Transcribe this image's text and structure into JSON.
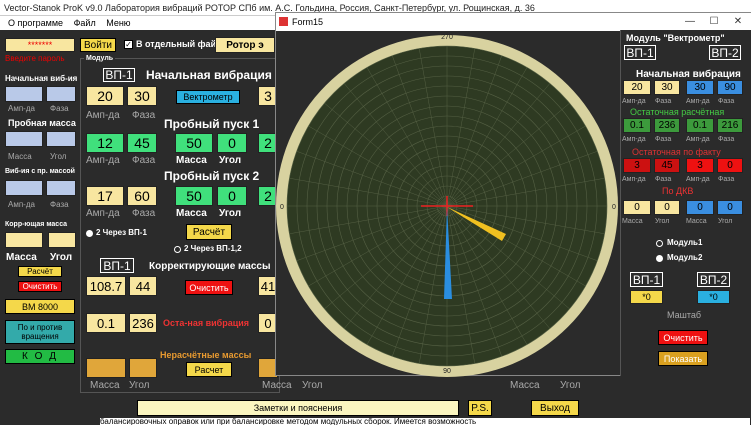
{
  "window_title": "Vector-Stanok ProK v9.0  Лаборатория вибраций РОТОР СПб им. А.С. Гольдина, Россия, Санкт-Петербург, ул. Рощинская, д. 36",
  "menu": [
    "О программе",
    "Файл",
    "Меню"
  ],
  "left": {
    "password": "*******",
    "login_btn": "Войти",
    "separate_file": "В отдельный файл",
    "rotor_label": "Ротор э",
    "enter_password": "Введите пароль",
    "initial_vib": "Начальная виб-ия",
    "amp": "Амп-да",
    "phase": "Фаза",
    "trial_mass": "Пробная масса",
    "mass": "Масса",
    "angle": "Угол",
    "vib_with_trial": "Виб-ия с пр. массой",
    "correction_mass": "Корр-ющая масса",
    "calc_btn": "Расчёт",
    "clear_btn": "Очистить",
    "vm_btn": "ВМ 8000",
    "rotation_btn": "По и против вращения",
    "kod_btn": "К О Д"
  },
  "middle": {
    "module_label": "Модуль",
    "vp1": "ВП-1",
    "initial_vibration": "Начальная вибрация",
    "amp": "Амп-да",
    "phase": "Фаза",
    "init_amp": "20",
    "init_phase": "30",
    "vectormeter": "Вектрометр",
    "trial1": "Пробный пуск 1",
    "t1_amp": "12",
    "t1_phase": "45",
    "t1_mass": "50",
    "t1_angle": "0",
    "trial2": "Пробный пуск 2",
    "t2_amp": "17",
    "t2_phase": "60",
    "t2_mass": "50",
    "t2_angle": "0",
    "mass": "Масса",
    "angle": "Угол",
    "via_vp1": "2 Через ВП-1",
    "via_vp12": "2 Через ВП-1,2",
    "calc": "Расчёт",
    "corr_masses": "Корректирующие массы",
    "corr_mass": "108.7",
    "corr_angle": "44",
    "clear": "Очистить",
    "res_mass": "0.1",
    "res_angle": "236",
    "residual_vib": "Оста-ная вибрация",
    "noncalc": "Нерасчётные массы",
    "calc2": "Расчет",
    "peek1": "3",
    "peek2": "2",
    "peek3": "2",
    "peek4": "41",
    "peek5": "0"
  },
  "bottom": {
    "notes": "Заметки и пояснения",
    "ps": "P.S.",
    "exit": "Выход",
    "footer_text": "балансировочных оправок или при балансировке методом модульных сборок. Имеется возможность",
    "mass": "Масса",
    "angle": "Угол"
  },
  "form15": {
    "title": "Form15",
    "dial_top": "270",
    "dial_bottom": "90",
    "dial_left": "0",
    "dial_right": "0",
    "min": "—",
    "max": "☐",
    "close": "✕"
  },
  "right": {
    "module_title": "Модуль \"Вектрометр\"",
    "vp1": "ВП-1",
    "vp2": "ВП-2",
    "initial": "Начальная вибрация",
    "v": [
      "20",
      "30",
      "30",
      "90"
    ],
    "ampfaza": [
      "Амп-да",
      "Фаза",
      "Амп-да",
      "Фаза"
    ],
    "residual_calc": "Остаточная расчётная",
    "rc": [
      "0.1",
      "236",
      "0.1",
      "216"
    ],
    "residual_fact": "Остаточная по факту",
    "rf": [
      "3",
      "45",
      "3",
      "0"
    ],
    "by_dkv": "По ДКВ",
    "dkv": [
      "0",
      "0",
      "0",
      "0"
    ],
    "mu": [
      "Масса",
      "Угол",
      "Масса",
      "Угол"
    ],
    "module1": "Модуль1",
    "module2": "Модуль2",
    "scale_vp1": "*0",
    "scale_vp2": "*0",
    "scale": "Маштаб",
    "clear": "Очистить",
    "show": "Показать"
  }
}
